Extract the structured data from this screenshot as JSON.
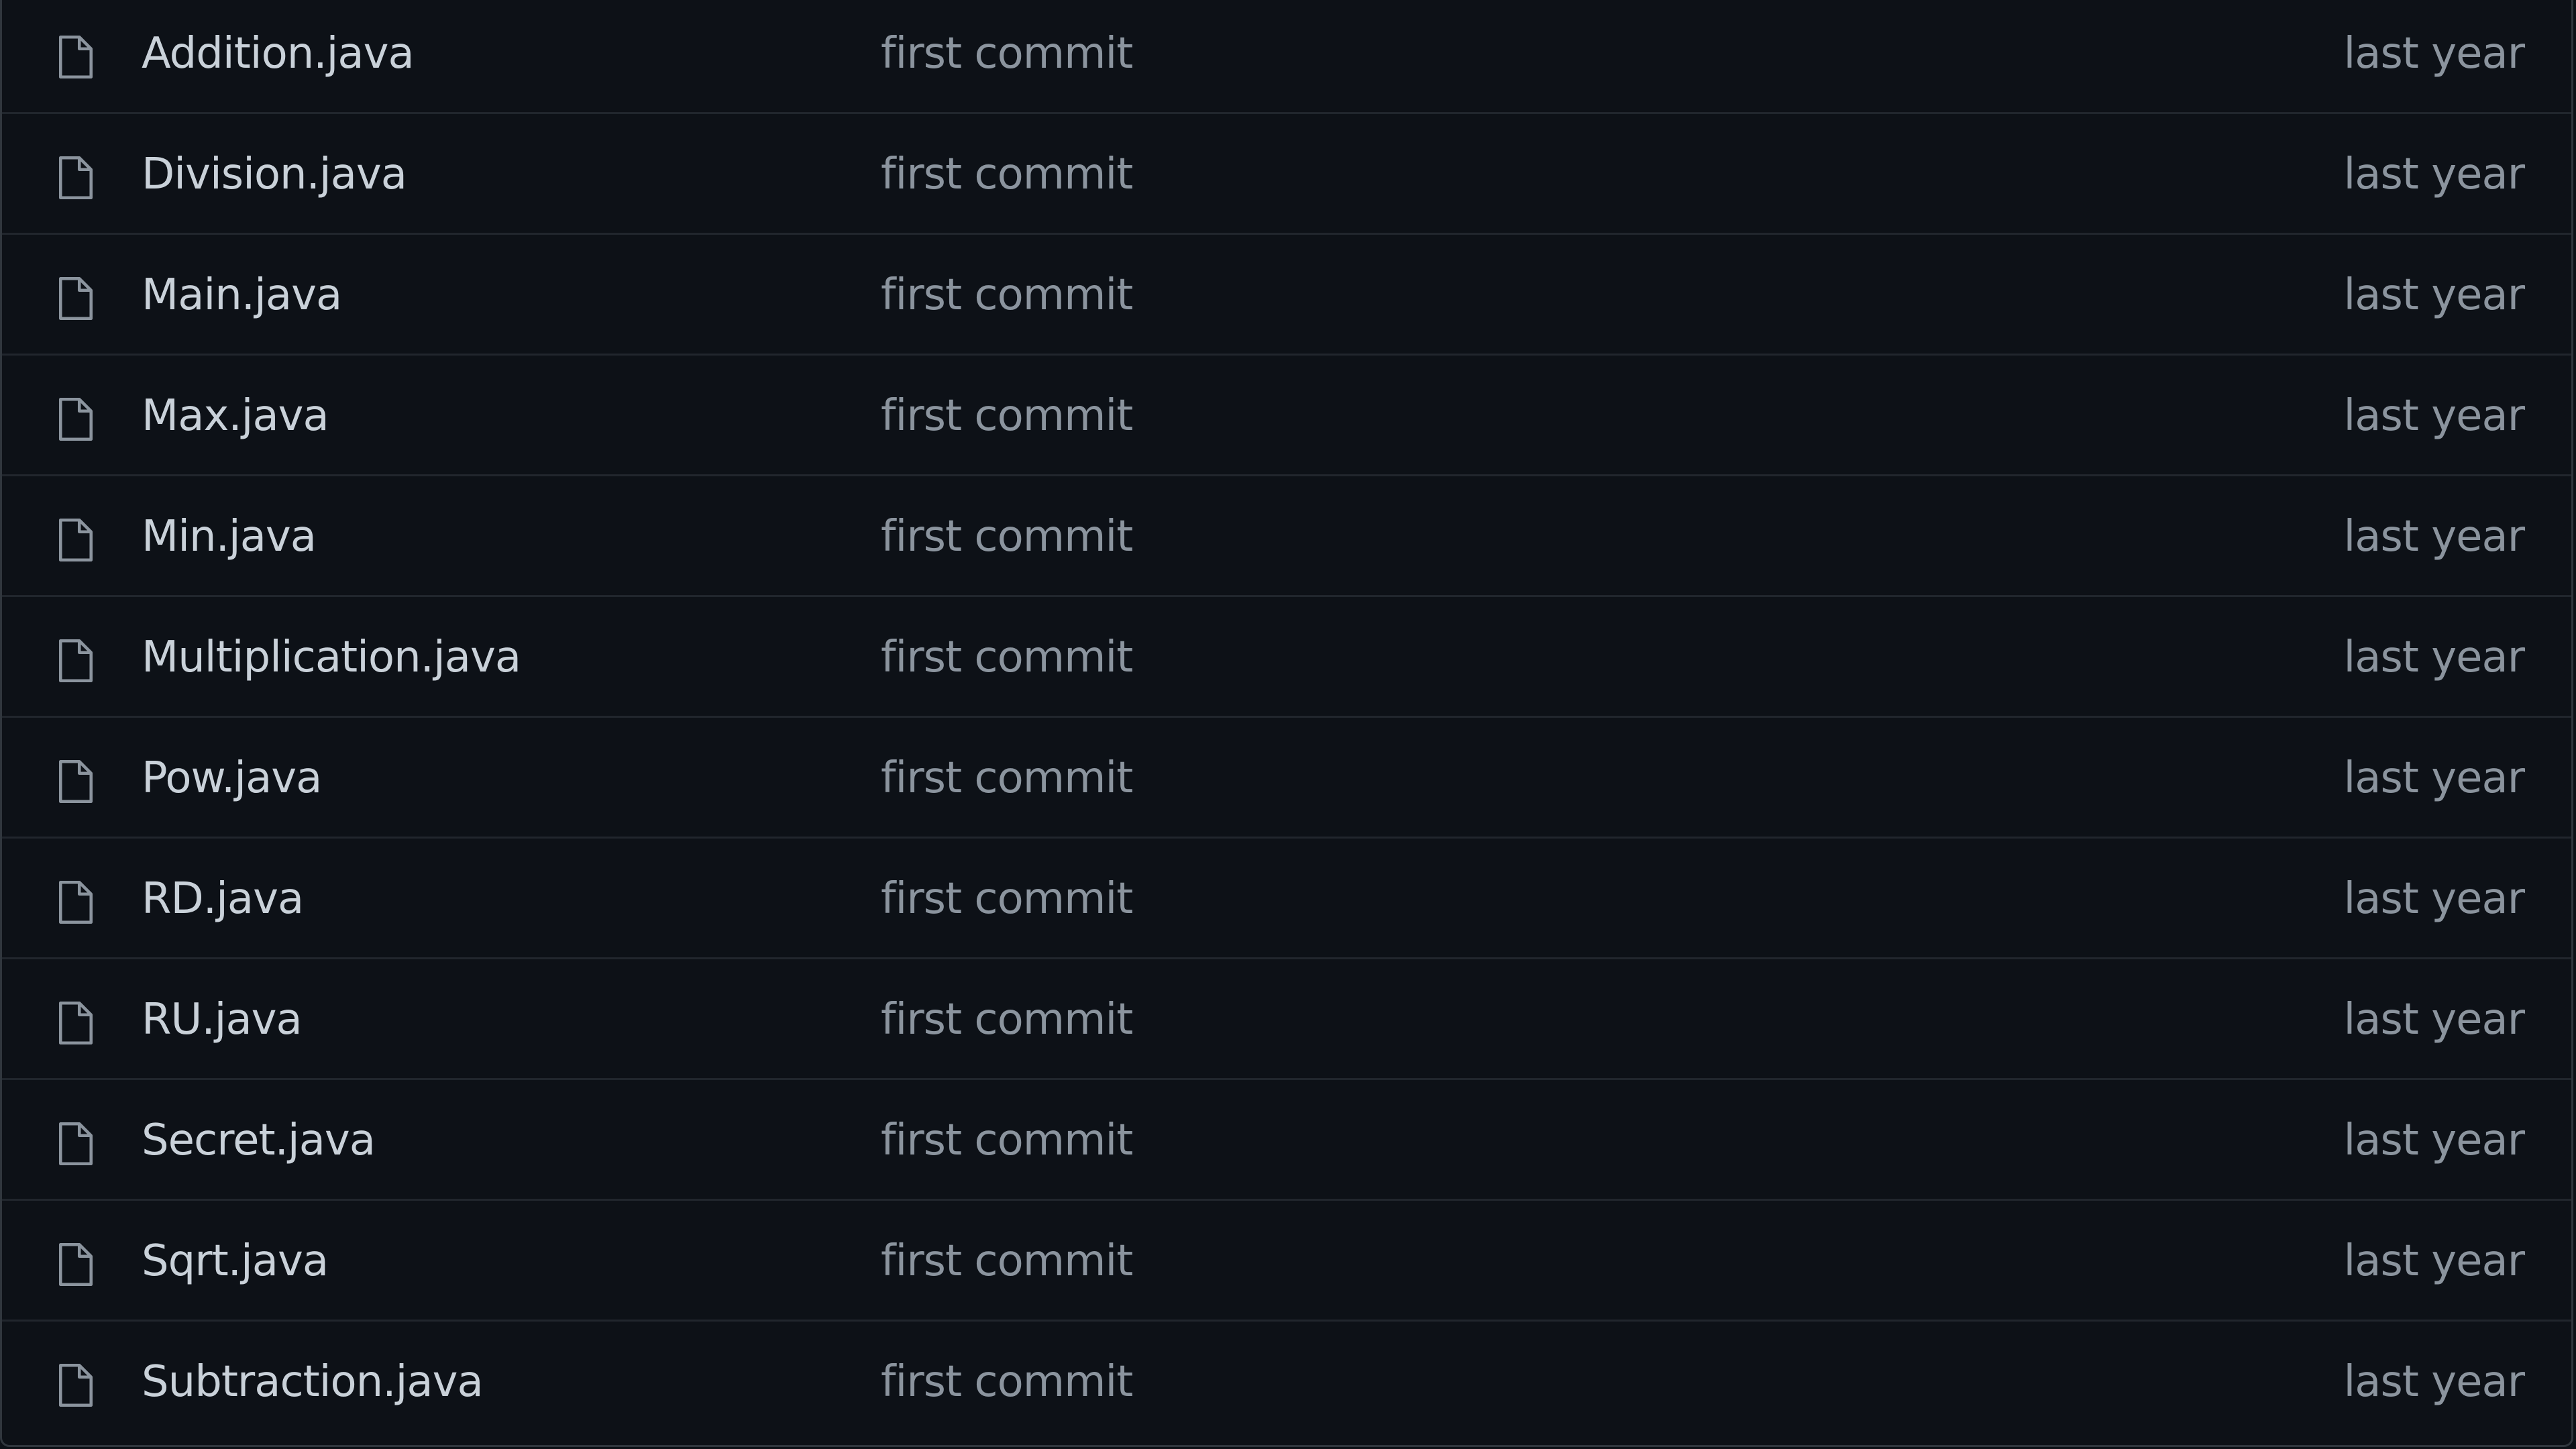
{
  "files": [
    {
      "icon": "file-icon",
      "name": "Addition.java",
      "commit": "first commit",
      "age": "last year"
    },
    {
      "icon": "file-icon",
      "name": "Division.java",
      "commit": "first commit",
      "age": "last year"
    },
    {
      "icon": "file-icon",
      "name": "Main.java",
      "commit": "first commit",
      "age": "last year"
    },
    {
      "icon": "file-icon",
      "name": "Max.java",
      "commit": "first commit",
      "age": "last year"
    },
    {
      "icon": "file-icon",
      "name": "Min.java",
      "commit": "first commit",
      "age": "last year"
    },
    {
      "icon": "file-icon",
      "name": "Multiplication.java",
      "commit": "first commit",
      "age": "last year"
    },
    {
      "icon": "file-icon",
      "name": "Pow.java",
      "commit": "first commit",
      "age": "last year"
    },
    {
      "icon": "file-icon",
      "name": "RD.java",
      "commit": "first commit",
      "age": "last year"
    },
    {
      "icon": "file-icon",
      "name": "RU.java",
      "commit": "first commit",
      "age": "last year"
    },
    {
      "icon": "file-icon",
      "name": "Secret.java",
      "commit": "first commit",
      "age": "last year"
    },
    {
      "icon": "file-icon",
      "name": "Sqrt.java",
      "commit": "first commit",
      "age": "last year"
    },
    {
      "icon": "file-icon",
      "name": "Subtraction.java",
      "commit": "first commit",
      "age": "last year"
    }
  ],
  "colors": {
    "background": "#0d1117",
    "border": "#30363d",
    "row_divider": "#21262d",
    "file_name": "#c9d1d9",
    "muted_text": "#8b949e",
    "icon": "#8b949e"
  }
}
